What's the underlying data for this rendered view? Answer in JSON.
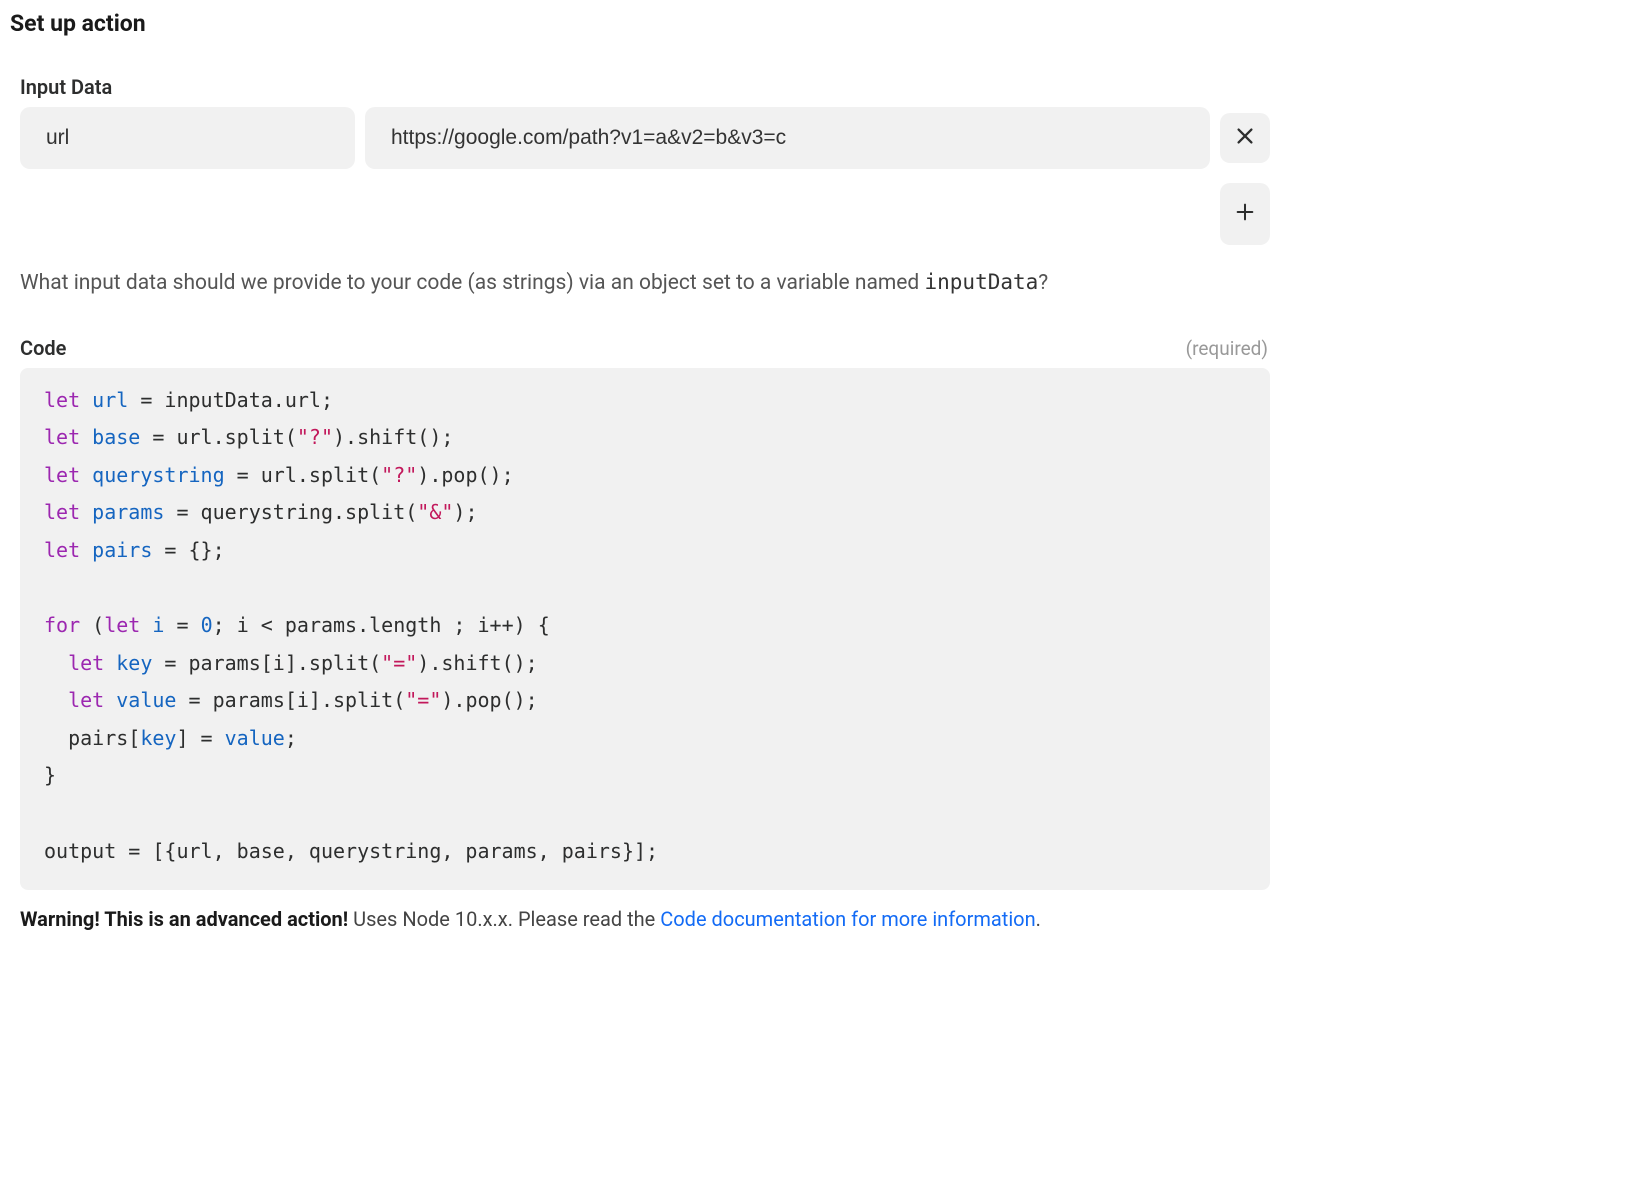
{
  "header": {
    "title": "Set up action"
  },
  "input_data": {
    "label": "Input Data",
    "rows": [
      {
        "key": "url",
        "value": "https://google.com/path?v1=a&v2=b&v3=c"
      }
    ],
    "helper_prefix": "What input data should we provide to your code (as strings) via an object set to a variable named ",
    "helper_code": "inputData",
    "helper_suffix": "?"
  },
  "code": {
    "label": "Code",
    "required_text": "(required)",
    "lines_html": "<span class=\"tok-kw\">let</span> <span class=\"tok-var\">url</span> = inputData.url;\n<span class=\"tok-kw\">let</span> <span class=\"tok-var\">base</span> = url.split(<span class=\"tok-str\">\"?\"</span>).shift();\n<span class=\"tok-kw\">let</span> <span class=\"tok-var\">querystring</span> = url.split(<span class=\"tok-str\">\"?\"</span>).pop();\n<span class=\"tok-kw\">let</span> <span class=\"tok-var\">params</span> = querystring.split(<span class=\"tok-str\">\"&amp;\"</span>);\n<span class=\"tok-kw\">let</span> <span class=\"tok-var\">pairs</span> = {};\n\n<span class=\"tok-kw\">for</span> (<span class=\"tok-kw\">let</span> <span class=\"tok-var\">i</span> = <span class=\"tok-num\">0</span>; i &lt; params.length ; i++) {\n  <span class=\"tok-kw\">let</span> <span class=\"tok-var\">key</span> = params[i].split(<span class=\"tok-str\">\"=\"</span>).shift();\n  <span class=\"tok-kw\">let</span> <span class=\"tok-var\">value</span> = params[i].split(<span class=\"tok-str\">\"=\"</span>).pop();\n  pairs[<span class=\"tok-var\">key</span>] = <span class=\"tok-var\">value</span>;\n}\n\noutput = [{url, base, querystring, params, pairs}];"
  },
  "warning": {
    "bold": "Warning! This is an advanced action!",
    "text": " Uses Node 10.x.x. Please read the ",
    "link_text": "Code documentation for more information",
    "period": "."
  }
}
